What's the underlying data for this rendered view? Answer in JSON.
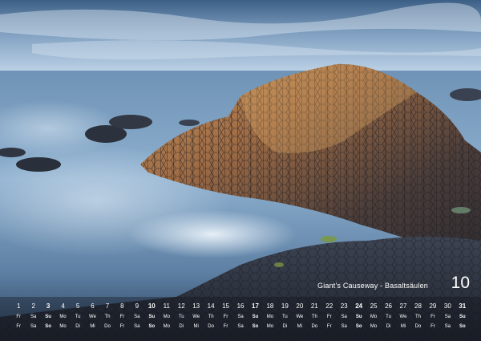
{
  "calendar": {
    "caption": "Giant's Causeway - Basaltsäulen",
    "month_number": "10",
    "days": [
      {
        "d": "1",
        "en": "Fr",
        "de": "Fr"
      },
      {
        "d": "2",
        "en": "Sa",
        "de": "Sa"
      },
      {
        "d": "3",
        "en": "Su",
        "de": "So"
      },
      {
        "d": "4",
        "en": "Mo",
        "de": "Mo"
      },
      {
        "d": "5",
        "en": "Tu",
        "de": "Di"
      },
      {
        "d": "6",
        "en": "We",
        "de": "Mi"
      },
      {
        "d": "7",
        "en": "Th",
        "de": "Do"
      },
      {
        "d": "8",
        "en": "Fr",
        "de": "Fr"
      },
      {
        "d": "9",
        "en": "Sa",
        "de": "Sa"
      },
      {
        "d": "10",
        "en": "Su",
        "de": "So"
      },
      {
        "d": "11",
        "en": "Mo",
        "de": "Mo"
      },
      {
        "d": "12",
        "en": "Tu",
        "de": "Di"
      },
      {
        "d": "13",
        "en": "We",
        "de": "Mi"
      },
      {
        "d": "14",
        "en": "Th",
        "de": "Do"
      },
      {
        "d": "15",
        "en": "Fr",
        "de": "Fr"
      },
      {
        "d": "16",
        "en": "Sa",
        "de": "Sa"
      },
      {
        "d": "17",
        "en": "Su",
        "de": "So"
      },
      {
        "d": "18",
        "en": "Mo",
        "de": "Mo"
      },
      {
        "d": "19",
        "en": "Tu",
        "de": "Di"
      },
      {
        "d": "20",
        "en": "We",
        "de": "Mi"
      },
      {
        "d": "21",
        "en": "Th",
        "de": "Do"
      },
      {
        "d": "22",
        "en": "Fr",
        "de": "Fr"
      },
      {
        "d": "23",
        "en": "Sa",
        "de": "Sa"
      },
      {
        "d": "24",
        "en": "Su",
        "de": "So"
      },
      {
        "d": "25",
        "en": "Mo",
        "de": "Mo"
      },
      {
        "d": "26",
        "en": "Tu",
        "de": "Di"
      },
      {
        "d": "27",
        "en": "We",
        "de": "Mi"
      },
      {
        "d": "28",
        "en": "Th",
        "de": "Do"
      },
      {
        "d": "29",
        "en": "Fr",
        "de": "Fr"
      },
      {
        "d": "30",
        "en": "Sa",
        "de": "Sa"
      },
      {
        "d": "31",
        "en": "Su",
        "de": "So"
      }
    ],
    "highlighted_days": [
      "3",
      "10",
      "17",
      "24",
      "31"
    ]
  }
}
